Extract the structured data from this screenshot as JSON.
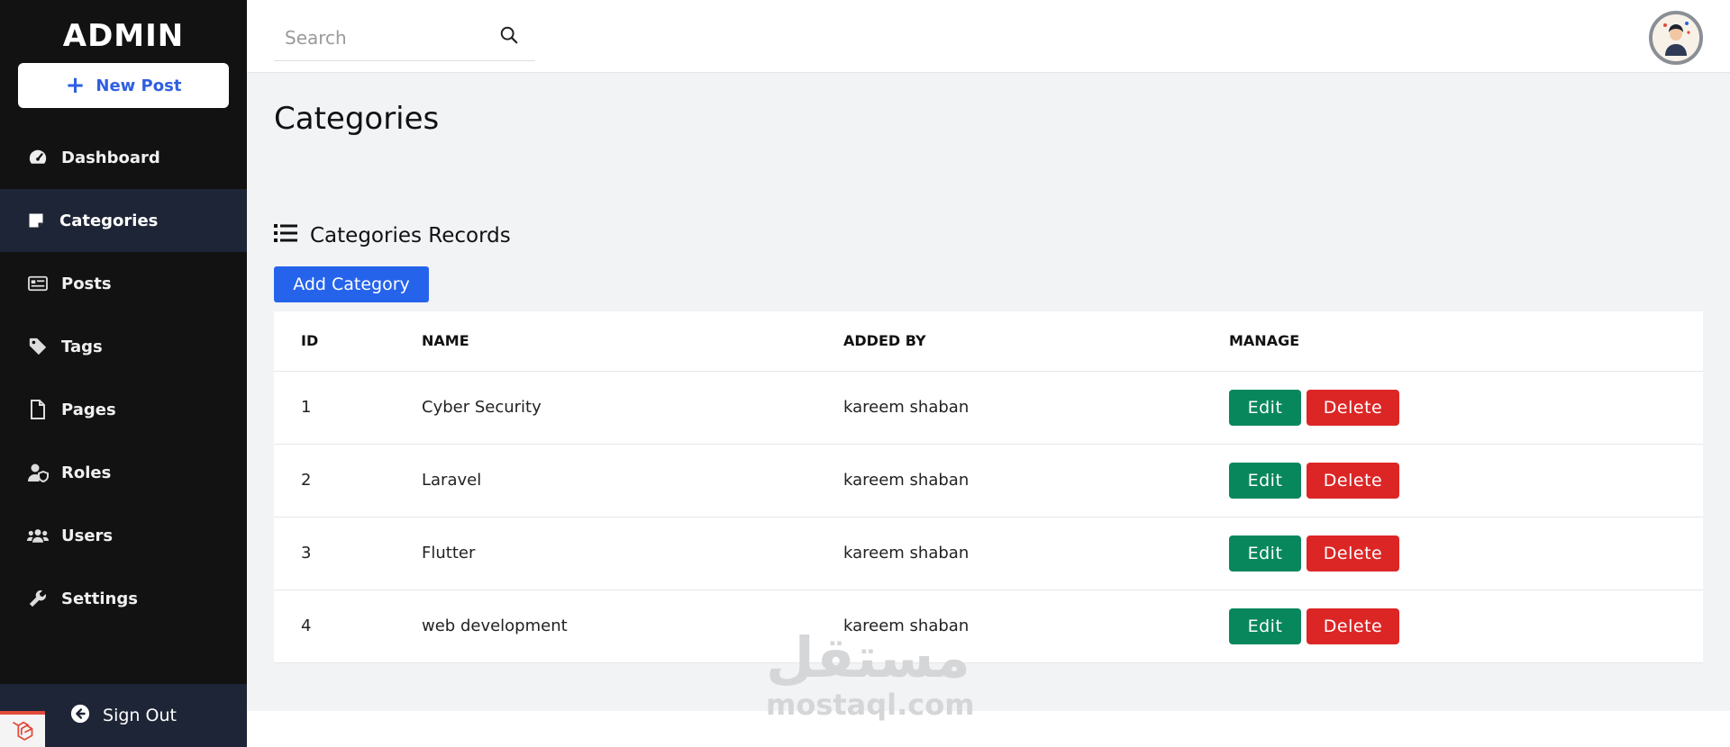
{
  "sidebar": {
    "brand": "ADMIN",
    "new_post_label": "New Post",
    "items": [
      {
        "label": "Dashboard",
        "icon": "gauge-icon",
        "active": false
      },
      {
        "label": "Categories",
        "icon": "sticky-note-icon",
        "active": true
      },
      {
        "label": "Posts",
        "icon": "newspaper-icon",
        "active": false
      },
      {
        "label": "Tags",
        "icon": "tag-icon",
        "active": false
      },
      {
        "label": "Pages",
        "icon": "file-icon",
        "active": false
      },
      {
        "label": "Roles",
        "icon": "user-shield-icon",
        "active": false
      },
      {
        "label": "Users",
        "icon": "users-icon",
        "active": false
      },
      {
        "label": "Settings",
        "icon": "wrench-icon",
        "active": false
      }
    ],
    "signout_label": "Sign Out"
  },
  "topbar": {
    "search_placeholder": "Search",
    "search_value": ""
  },
  "main": {
    "page_title": "Categories",
    "records_title": "Categories Records",
    "add_button": "Add Category",
    "table": {
      "headers": [
        "ID",
        "NAME",
        "ADDED BY",
        "MANAGE"
      ],
      "rows": [
        {
          "id": "1",
          "name": "Cyber Security",
          "added_by": "kareem shaban"
        },
        {
          "id": "2",
          "name": "Laravel",
          "added_by": "kareem shaban"
        },
        {
          "id": "3",
          "name": "Flutter",
          "added_by": "kareem shaban"
        },
        {
          "id": "4",
          "name": "web development",
          "added_by": "kareem shaban"
        }
      ],
      "edit_label": "Edit",
      "delete_label": "Delete"
    }
  },
  "watermark": {
    "arabic": "مستقل",
    "latin": "mostaql.com"
  },
  "colors": {
    "sidebar_bg": "#121212",
    "sidebar_active": "#1e2536",
    "accent_blue": "#2563eb",
    "edit_green": "#08875d",
    "delete_red": "#dc2626"
  }
}
